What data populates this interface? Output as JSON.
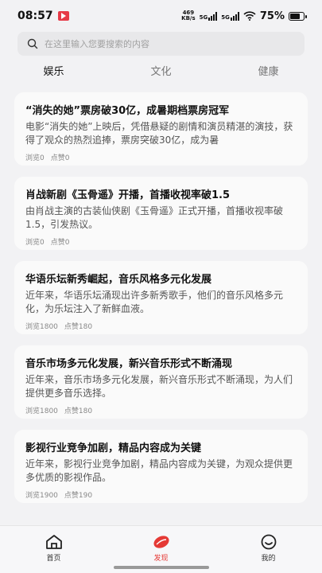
{
  "status_bar": {
    "time": "08:57",
    "net_speed_value": "469",
    "net_speed_unit": "KB/s",
    "sig1": "5G",
    "sig2": "5G",
    "battery": "75%"
  },
  "search": {
    "placeholder": "在这里输入您要搜索的内容"
  },
  "tabs": [
    {
      "label": "娱乐",
      "active": true
    },
    {
      "label": "文化",
      "active": false
    },
    {
      "label": "健康",
      "active": false
    }
  ],
  "cards": [
    {
      "title": "“消失的她”票房破30亿，成暑期档票房冠军",
      "desc": "电影“消失的她”上映后，凭借悬疑的剧情和演员精湛的演技，获得了观众的热烈追捧，票房突破30亿，成为暑",
      "views": "浏览0",
      "likes": "点赞0"
    },
    {
      "title": "肖战新剧《玉骨遥》开播，首播收视率破1.5",
      "desc": "由肖战主演的古装仙侠剧《玉骨遥》正式开播，首播收视率破1.5，引发热议。",
      "views": "浏览0",
      "likes": "点赞0"
    },
    {
      "title": "华语乐坛新秀崛起，音乐风格多元化发展",
      "desc": "近年来，华语乐坛涌现出许多新秀歌手，他们的音乐风格多元化，为乐坛注入了新鲜血液。",
      "views": "浏览1800",
      "likes": "点赞180"
    },
    {
      "title": "音乐市场多元化发展，新兴音乐形式不断涌现",
      "desc": "近年来，音乐市场多元化发展，新兴音乐形式不断涌现，为人们提供更多音乐选择。",
      "views": "浏览1800",
      "likes": "点赞180"
    },
    {
      "title": "影视行业竞争加剧，精品内容成为关键",
      "desc": "近年来，影视行业竞争加剧，精品内容成为关键，为观众提供更多优质的影视作品。",
      "views": "浏览1900",
      "likes": "点赞190"
    }
  ],
  "bottom_nav": [
    {
      "label": "首页",
      "icon": "home-icon",
      "active": false
    },
    {
      "label": "发现",
      "icon": "discover-icon",
      "active": true
    },
    {
      "label": "我的",
      "icon": "smiley-icon",
      "active": false
    }
  ],
  "colors": {
    "accent": "#e53935",
    "background": "#f2f2f4",
    "card": "#fafafa"
  }
}
